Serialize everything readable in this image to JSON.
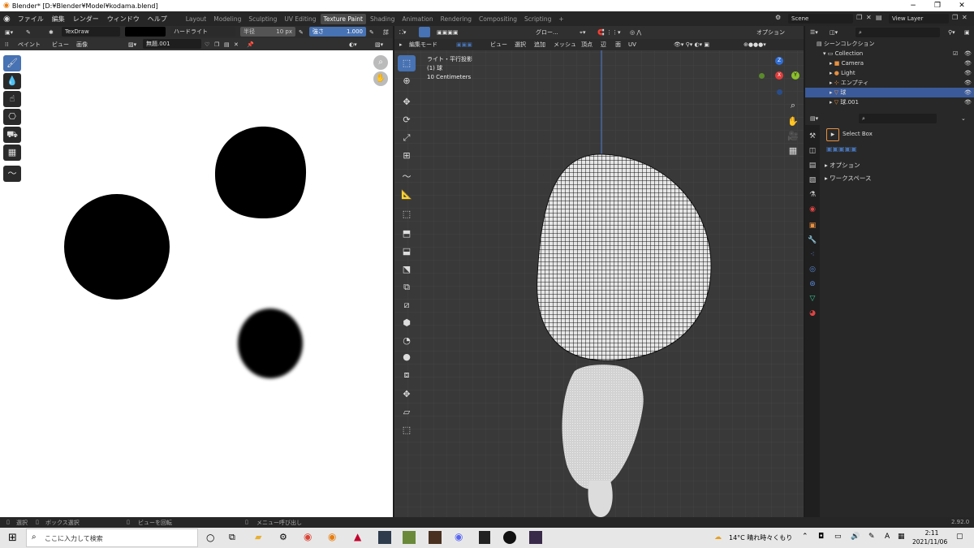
{
  "window": {
    "title": "Blender* [D:¥Blender¥Model¥kodama.blend]",
    "minimize": "−",
    "maximize": "❐",
    "close": "✕"
  },
  "menu": [
    "ファイル",
    "編集",
    "レンダー",
    "ウィンドウ",
    "ヘルプ"
  ],
  "workspaces": [
    "Layout",
    "Modeling",
    "Sculpting",
    "UV Editing",
    "Texture Paint",
    "Shading",
    "Animation",
    "Rendering",
    "Compositing",
    "Scripting",
    "+"
  ],
  "active_workspace": "Texture Paint",
  "scene": {
    "label": "Scene",
    "view_layer": "View Layer"
  },
  "tool_header": {
    "brush_name": "TexDraw",
    "blend_mode": "ハードライト",
    "radius_label": "半径",
    "radius_value": "10 px",
    "strength_label": "強さ",
    "strength_value": "1.000",
    "extra": "詳"
  },
  "image_header": {
    "mode": "ペイント",
    "view": "ビュー",
    "image": "画像",
    "image_name": "無題.001"
  },
  "viewport_header": {
    "mode": "編集モード",
    "view": "ビュー",
    "select": "選択",
    "add": "追加",
    "mesh": "メッシュ",
    "vertex": "頂点",
    "edge": "辺",
    "face": "面",
    "uv": "UV",
    "transform": "グロー...",
    "options": "オプション"
  },
  "viewport_overlay": {
    "line1": "ライト・平行投影",
    "line2": "(1) 球",
    "line3": "10 Centimeters"
  },
  "gizmo": {
    "x": "X",
    "y": "Y",
    "z": "Z"
  },
  "outliner": {
    "search_placeholder": "",
    "root": "シーンコレクション",
    "collection": "Collection",
    "items": [
      {
        "name": "Camera",
        "icon": "camera-icon"
      },
      {
        "name": "Light",
        "icon": "light-icon"
      },
      {
        "name": "エンプティ",
        "icon": "empty-icon"
      },
      {
        "name": "球",
        "icon": "mesh-icon",
        "selected": true
      },
      {
        "name": "球.001",
        "icon": "mesh-icon"
      }
    ]
  },
  "properties": {
    "tool_name": "Select Box",
    "sections": [
      "オプション",
      "ワークスペース"
    ]
  },
  "statusbar": {
    "select": "選択",
    "box_select": "ボックス選択",
    "rotate": "ビューを回転",
    "menu": "メニュー呼び出し",
    "version": "2.92.0"
  },
  "taskbar": {
    "search": "ここに入力して検索",
    "weather": "14°C  晴れ時々くもり",
    "time": "2:11",
    "date": "2021/11/06",
    "ime": "A"
  },
  "colors": {
    "accent": "#4772b3",
    "header": "#303030",
    "viewport": "#393939",
    "panel": "#282828"
  }
}
